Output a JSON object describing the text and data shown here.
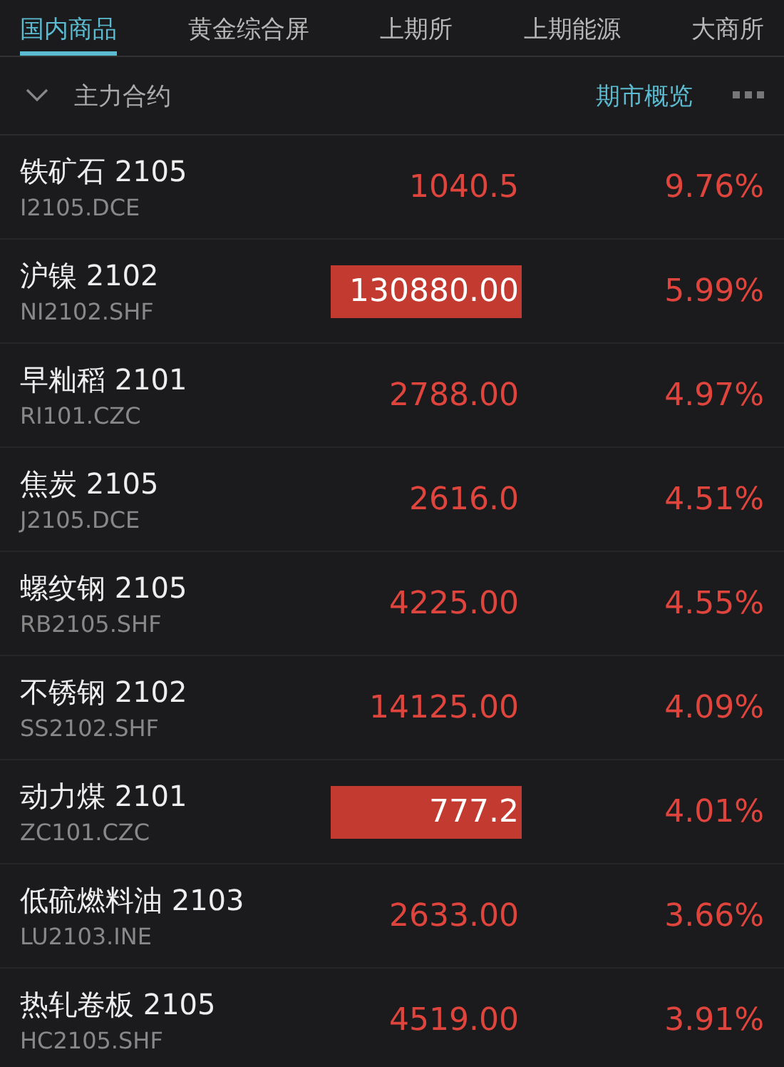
{
  "tabs": [
    {
      "label": "国内商品",
      "selected": true
    },
    {
      "label": "黄金综合屏",
      "selected": false
    },
    {
      "label": "上期所",
      "selected": false
    },
    {
      "label": "上期能源",
      "selected": false
    },
    {
      "label": "大商所",
      "selected": false
    }
  ],
  "section": {
    "title": "主力合约",
    "expanded": true,
    "link": "期市概览"
  },
  "rows": [
    {
      "name": "铁矿石 2105",
      "code": "I2105.DCE",
      "price": "1040.5",
      "change": "9.76%",
      "highlighted": false
    },
    {
      "name": "沪镍 2102",
      "code": "NI2102.SHF",
      "price": "130880.00",
      "change": "5.99%",
      "highlighted": true
    },
    {
      "name": "早籼稻 2101",
      "code": "RI101.CZC",
      "price": "2788.00",
      "change": "4.97%",
      "highlighted": false
    },
    {
      "name": "焦炭 2105",
      "code": "J2105.DCE",
      "price": "2616.0",
      "change": "4.51%",
      "highlighted": false
    },
    {
      "name": "螺纹钢 2105",
      "code": "RB2105.SHF",
      "price": "4225.00",
      "change": "4.55%",
      "highlighted": false
    },
    {
      "name": "不锈钢 2102",
      "code": "SS2102.SHF",
      "price": "14125.00",
      "change": "4.09%",
      "highlighted": false
    },
    {
      "name": "动力煤 2101",
      "code": "ZC101.CZC",
      "price": "777.2",
      "change": "4.01%",
      "highlighted": true
    },
    {
      "name": "低硫燃料油 2103",
      "code": "LU2103.INE",
      "price": "2633.00",
      "change": "3.66%",
      "highlighted": false
    },
    {
      "name": "热轧卷板 2105",
      "code": "HC2105.SHF",
      "price": "4519.00",
      "change": "3.91%",
      "highlighted": false
    }
  ]
}
